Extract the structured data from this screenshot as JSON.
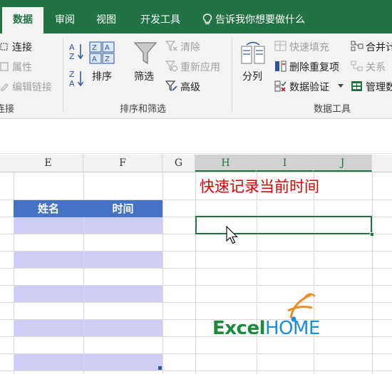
{
  "tabs": {
    "data": "数据",
    "review": "审阅",
    "view": "视图",
    "developer": "开发工具"
  },
  "tell_me": "告诉我你想要做什么",
  "ribbon": {
    "connections": {
      "connect": "连接",
      "properties": "属性",
      "edit_links": "编辑链接",
      "group_label": "连接"
    },
    "sort_filter": {
      "sort": "排序",
      "filter": "筛选",
      "clear": "清除",
      "reapply": "重新应用",
      "advanced": "高级",
      "group_label": "排序和筛选"
    },
    "data_tools": {
      "split_column": "分列",
      "flash_fill": "快速填充",
      "remove_duplicates": "删除重复项",
      "data_validation": "数据验证",
      "consolidate": "合并计",
      "relationships": "关系",
      "manage_model": "管理数",
      "group_label": "数据工具"
    }
  },
  "columns": [
    "E",
    "F",
    "G",
    "H",
    "I",
    "J"
  ],
  "table": {
    "headers": [
      "姓名",
      "时间"
    ]
  },
  "caption": "快速记录当前时间",
  "logo": {
    "part1": "Excel",
    "part2": "HOME"
  },
  "colors": {
    "excel_green": "#217346",
    "table_header": "#4472c4",
    "table_band": "#ccccf5",
    "caption_red": "#e00000"
  }
}
